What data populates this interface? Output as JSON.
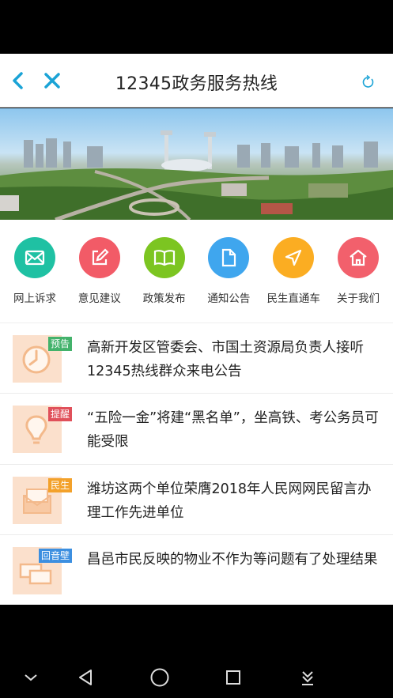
{
  "header": {
    "title": "12345政务服务热线"
  },
  "icons": {
    "back": "chevron-left-icon",
    "close": "close-icon",
    "refresh": "refresh-icon"
  },
  "quick_links": [
    {
      "label": "网上诉求",
      "color": "#1fc1a3",
      "icon": "mail-icon"
    },
    {
      "label": "意见建议",
      "color": "#f25b67",
      "icon": "edit-icon"
    },
    {
      "label": "政策发布",
      "color": "#7cc521",
      "icon": "book-icon"
    },
    {
      "label": "通知公告",
      "color": "#3fa6ee",
      "icon": "document-icon"
    },
    {
      "label": "民生直通车",
      "color": "#fbad22",
      "icon": "navigation-icon"
    },
    {
      "label": "关于我们",
      "color": "#f2606c",
      "icon": "home-icon"
    }
  ],
  "news": [
    {
      "tag": "预告",
      "tag_color": "#43b26b",
      "text": "高新开发区管委会、市国土资源局负责人接听12345热线群众来电公告"
    },
    {
      "tag": "提醒",
      "tag_color": "#e0505a",
      "text": "“五险一金”将建“黑名单”，坐高铁、考公务员可能受限"
    },
    {
      "tag": "民生",
      "tag_color": "#f3a12a",
      "text": "潍坊这两个单位荣膺2018年人民网网民留言办理工作先进单位"
    },
    {
      "tag": "回音壁",
      "tag_color": "#3c8fe0",
      "text": "昌邑市民反映的物业不作为等问题有了处理结果"
    }
  ],
  "colors": {
    "accent": "#1aa3d6",
    "thumb_bg": "#fbe0cc"
  }
}
